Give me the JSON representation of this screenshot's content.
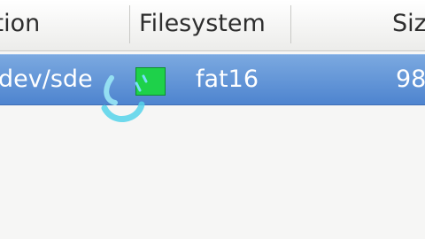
{
  "columns": {
    "partition": "ition",
    "filesystem": "Filesystem",
    "size": "Siz"
  },
  "row": {
    "partition": "dev/sde",
    "filesystem": "fat16",
    "size": "98",
    "filesystem_color": "#1ed14a"
  },
  "icons": {
    "cursor": "busy-cursor-icon"
  }
}
